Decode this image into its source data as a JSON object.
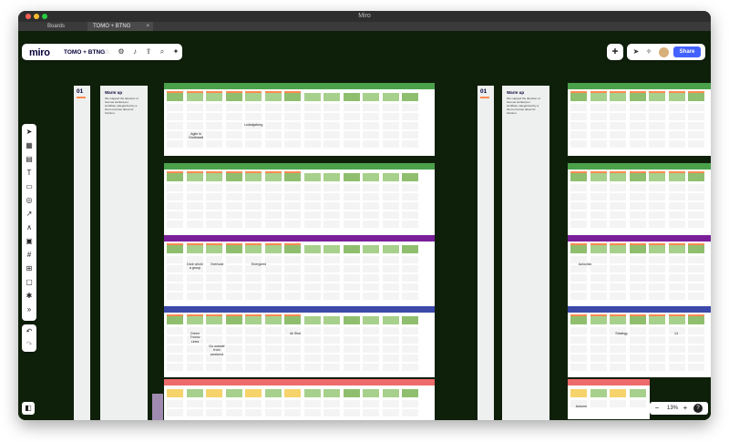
{
  "window": {
    "title": "Miro",
    "tabs": [
      {
        "label": "Boards"
      },
      {
        "label": "TOMO + BTNG"
      }
    ]
  },
  "board": {
    "logo": "miro",
    "name": "TOMO + BTNG",
    "share_label": "Share",
    "zoom": "13%",
    "zoom_minus": "−",
    "zoom_plus": "+",
    "help": "?"
  },
  "sections": [
    {
      "number": "01",
      "title": "Warm up",
      "desc": "We mapped the direction of how we worked per workflow, categorized by a short one-liner about its function."
    },
    {
      "number": "01",
      "title": "Warm up",
      "desc": "We mapped the direction of how we worked per workflow, categorized by a short one-liner about its function."
    }
  ],
  "big_notes": [
    {
      "text": "Ludwigsburg"
    },
    {
      "text": "Agile in Großstadt"
    },
    {
      "text": "Dark whole a group"
    },
    {
      "text": "Overload"
    },
    {
      "text": "Energized"
    },
    {
      "text": "Green Thuruv Lines"
    },
    {
      "text": "Go outside from weekend"
    },
    {
      "text": "4k Shot"
    },
    {
      "text": "Autoclick"
    },
    {
      "text": "Strategy"
    },
    {
      "text": "14"
    },
    {
      "text": "Autumn"
    }
  ],
  "colors": {
    "canvas": "#0f200a",
    "frame_green": "#4aa14a",
    "frame_purple": "#7a1f9a",
    "frame_blue": "#3c49a8",
    "frame_red": "#ee6b6b",
    "sticky_green": "#a7d08c",
    "accent": "#4262ff"
  }
}
